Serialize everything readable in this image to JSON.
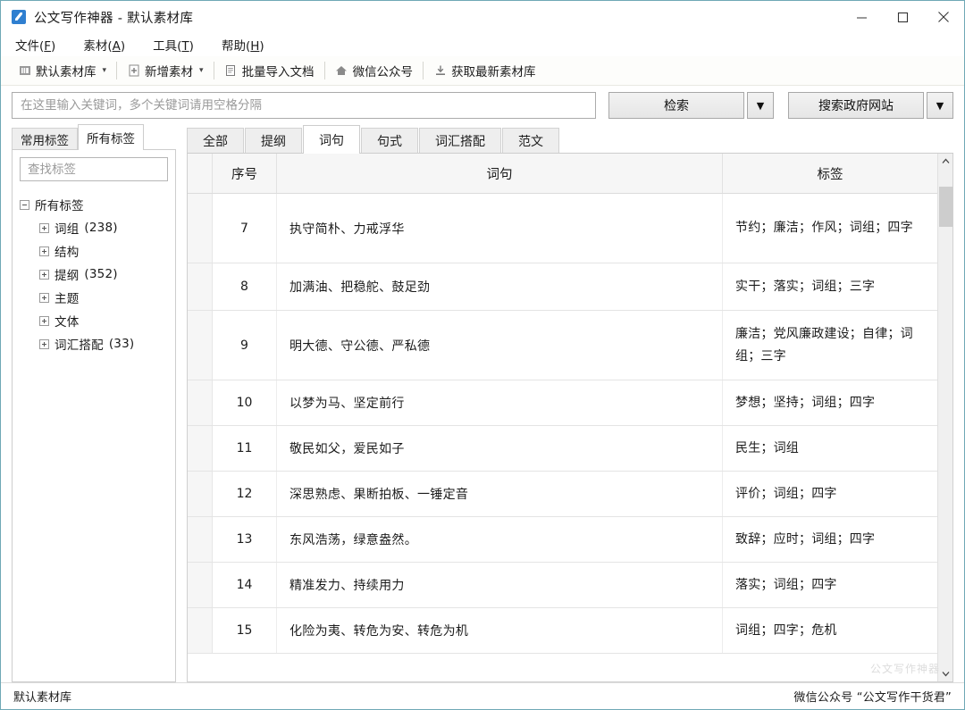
{
  "window": {
    "title": "公文写作神器 - 默认素材库",
    "icon": "app-pencil-icon",
    "controls": {
      "minimize": "–",
      "maximize": "□",
      "close": "✕"
    }
  },
  "menubar": [
    {
      "label": "文件",
      "accel": "F"
    },
    {
      "label": "素材",
      "accel": "A"
    },
    {
      "label": "工具",
      "accel": "T"
    },
    {
      "label": "帮助",
      "accel": "H"
    }
  ],
  "toolbar": [
    {
      "label": "默认素材库",
      "icon": "library-icon",
      "caret": "▾"
    },
    {
      "label": "新增素材",
      "icon": "add-document-icon",
      "caret": "▾"
    },
    {
      "label": "批量导入文档",
      "icon": "batch-import-icon",
      "caret": ""
    },
    {
      "label": "微信公众号",
      "icon": "home-icon",
      "caret": ""
    },
    {
      "label": "获取最新素材库",
      "icon": "download-icon",
      "caret": ""
    }
  ],
  "search": {
    "placeholder": "在这里输入关键词，多个关键词请用空格分隔",
    "value": "",
    "search_button": "检索",
    "search_arrow": "▼",
    "gov_button": "搜索政府网站",
    "gov_arrow": "▼"
  },
  "left_panel": {
    "tabs": [
      {
        "label": "常用标签",
        "active": false
      },
      {
        "label": "所有标签",
        "active": true
      }
    ],
    "tag_search_placeholder": "查找标签",
    "tag_search_value": "",
    "tree_root": {
      "label": "所有标签",
      "state": "expanded"
    },
    "tree_items": [
      {
        "label": "词组",
        "count": "(238)",
        "state": "collapsed"
      },
      {
        "label": "结构",
        "count": "",
        "state": "collapsed"
      },
      {
        "label": "提纲",
        "count": "(352)",
        "state": "collapsed"
      },
      {
        "label": "主题",
        "count": "",
        "state": "collapsed"
      },
      {
        "label": "文体",
        "count": "",
        "state": "collapsed"
      },
      {
        "label": "词汇搭配",
        "count": "(33)",
        "state": "collapsed"
      }
    ]
  },
  "main": {
    "tabs": [
      {
        "label": "全部",
        "active": false
      },
      {
        "label": "提纲",
        "active": false
      },
      {
        "label": "词句",
        "active": true
      },
      {
        "label": "句式",
        "active": false
      },
      {
        "label": "词汇搭配",
        "active": false
      },
      {
        "label": "范文",
        "active": false
      }
    ],
    "columns": [
      "序号",
      "词句",
      "标签"
    ],
    "rows": [
      {
        "no": "7",
        "text": "执守简朴、力戒浮华",
        "tags": "节约；廉洁；作风；词组；四字",
        "tall": true
      },
      {
        "no": "8",
        "text": "加满油、把稳舵、鼓足劲",
        "tags": "实干；落实；词组；三字",
        "tall": false
      },
      {
        "no": "9",
        "text": "明大德、守公德、严私德",
        "tags": "廉洁；党风廉政建设；自律；词组；三字",
        "tall": true
      },
      {
        "no": "10",
        "text": "以梦为马、坚定前行",
        "tags": "梦想；坚持；词组；四字",
        "tall": false
      },
      {
        "no": "11",
        "text": "敬民如父，爱民如子",
        "tags": "民生；词组",
        "tall": false
      },
      {
        "no": "12",
        "text": "深思熟虑、果断拍板、一锤定音",
        "tags": "评价；词组；四字",
        "tall": false
      },
      {
        "no": "13",
        "text": "东风浩荡，绿意盎然。",
        "tags": "致辞；应时；词组；四字",
        "tall": false
      },
      {
        "no": "14",
        "text": "精准发力、持续用力",
        "tags": "落实；词组；四字",
        "tall": false
      },
      {
        "no": "15",
        "text": "化险为夷、转危为安、转危为机",
        "tags": "词组；四字；危机",
        "tall": false
      }
    ],
    "scroll_up": "⌃",
    "scroll_down": "⌄",
    "watermark": "公文写作神器"
  },
  "statusbar": {
    "left": "默认素材库",
    "right": "微信公众号 “公文写作干货君”"
  }
}
